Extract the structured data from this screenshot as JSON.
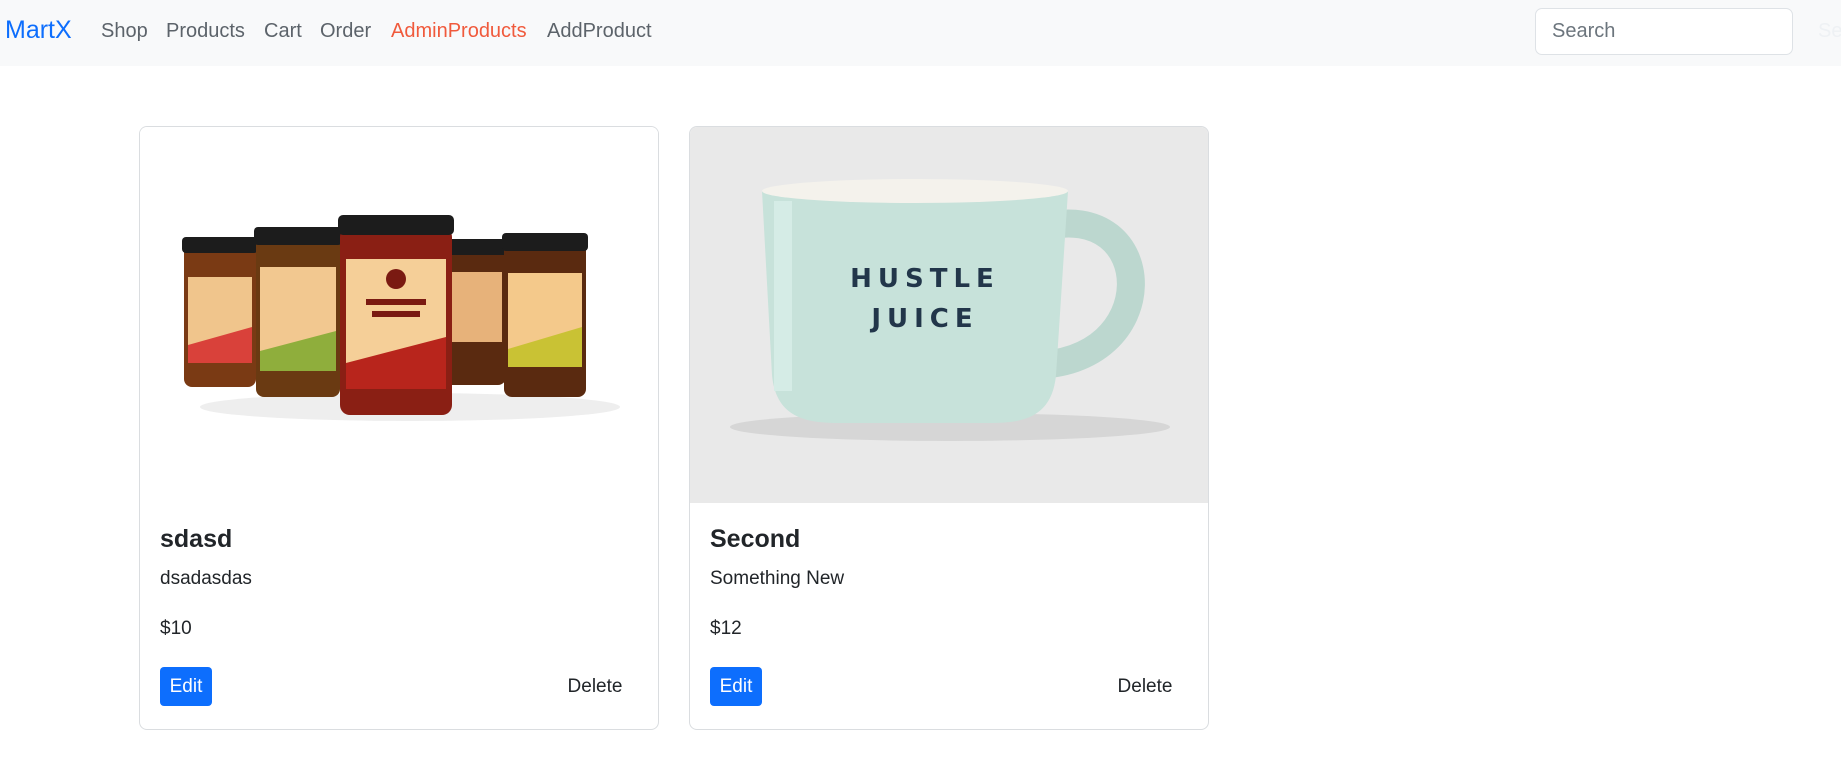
{
  "navbar": {
    "brand": "MartX",
    "links": [
      {
        "label": "Shop",
        "active": false
      },
      {
        "label": "Products",
        "active": false
      },
      {
        "label": "Cart",
        "active": false
      },
      {
        "label": "Order",
        "active": false
      },
      {
        "label": "AdminProducts",
        "active": true
      },
      {
        "label": "AddProduct",
        "active": false
      }
    ],
    "search": {
      "placeholder": "Search",
      "value": ""
    },
    "search_button_label": "Search"
  },
  "colors": {
    "brand": "#0d6efd",
    "active_link": "#f05a3c",
    "edit_button": "#0d6efd",
    "navbar_bg": "#f8f9fa"
  },
  "products": [
    {
      "title": "sdasd",
      "description": "dsadasdas",
      "price": "$10",
      "image_icon": "relish-jars-image",
      "edit_label": "Edit",
      "delete_label": "Delete"
    },
    {
      "title": "Second",
      "description": "Something New",
      "price": "$12",
      "image_icon": "mug-image",
      "mug_text": [
        "HUSTLE",
        "JUICE"
      ],
      "edit_label": "Edit",
      "delete_label": "Delete"
    }
  ]
}
